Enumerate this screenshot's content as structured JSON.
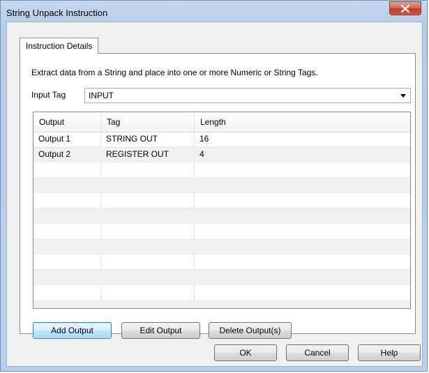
{
  "window": {
    "title": "String Unpack Instruction"
  },
  "tabs": [
    {
      "label": "Instruction Details"
    }
  ],
  "description": "Extract data from a String and place into one or more Numeric or String Tags.",
  "input_tag": {
    "label": "Input Tag",
    "value": "INPUT"
  },
  "table": {
    "columns": [
      "Output",
      "Tag",
      "Length"
    ],
    "rows": [
      {
        "output": "Output 1",
        "tag": "STRING OUT",
        "length": "16"
      },
      {
        "output": "Output 2",
        "tag": "REGISTER OUT",
        "length": "4"
      }
    ]
  },
  "buttons": {
    "add_output": "Add Output",
    "edit_output": "Edit Output",
    "delete_outputs": "Delete Output(s)",
    "ok": "OK",
    "cancel": "Cancel",
    "help": "Help"
  },
  "icons": {
    "close": "close-icon",
    "dropdown": "chevron-down-icon"
  },
  "colors": {
    "close_button": "#c23b26",
    "default_button_border": "#3c7fb1"
  }
}
